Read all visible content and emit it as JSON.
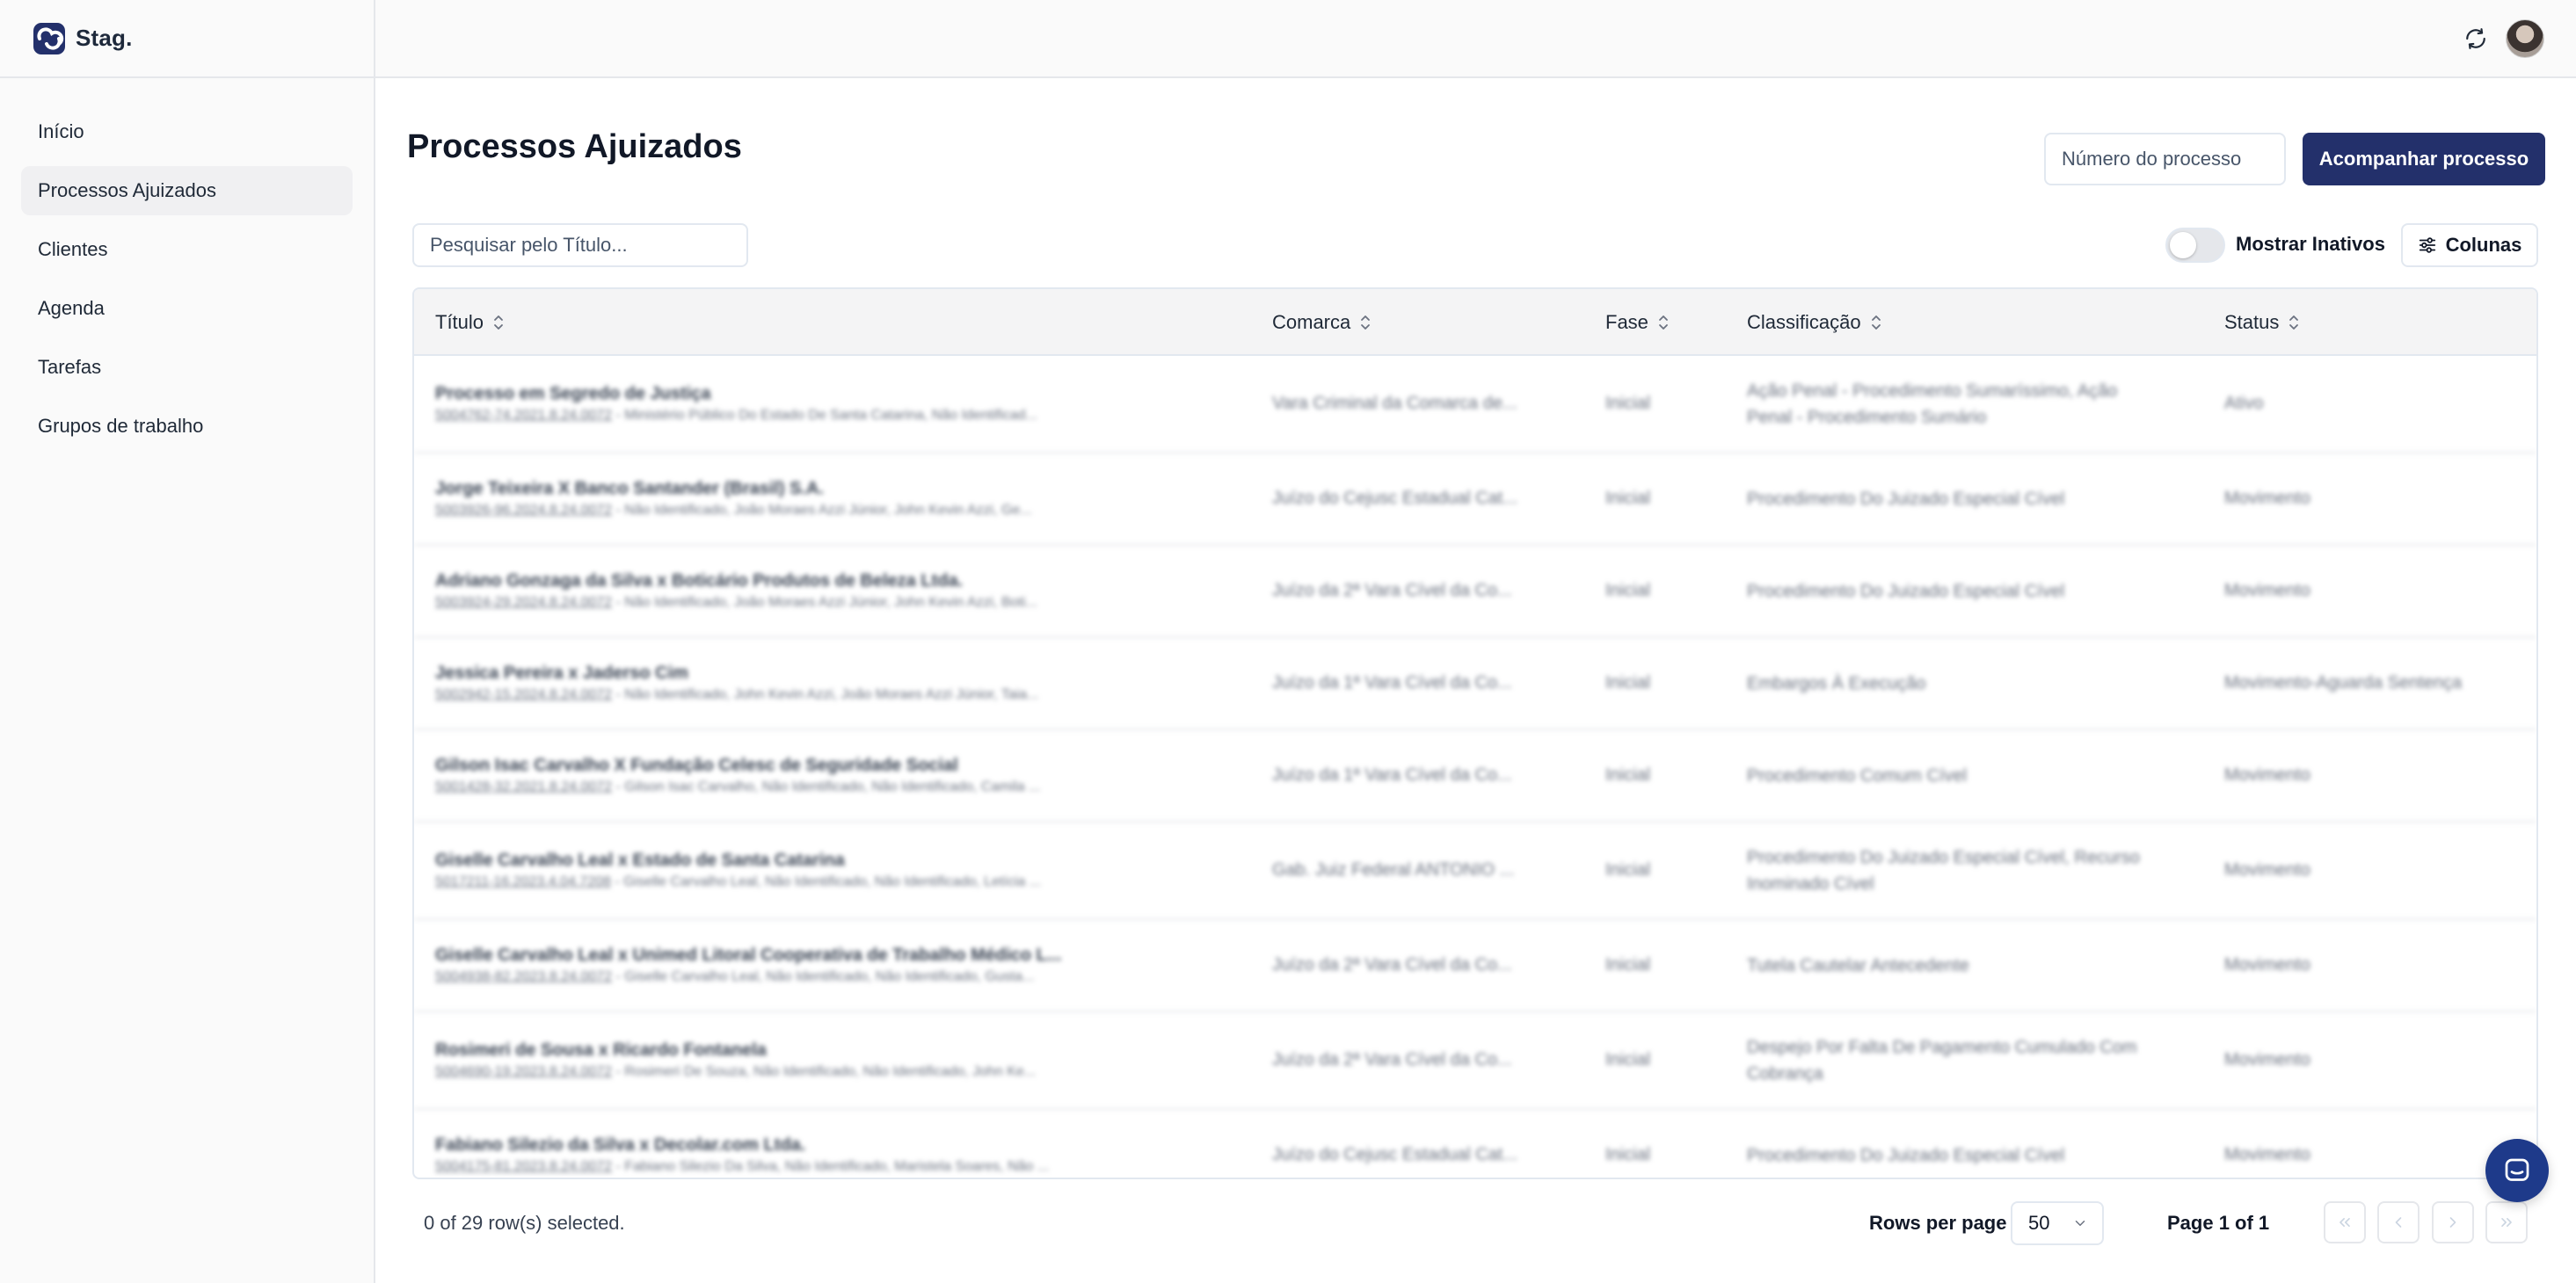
{
  "brand": {
    "name": "Stag."
  },
  "sidebar": {
    "items": [
      {
        "label": "Início",
        "active": false
      },
      {
        "label": "Processos Ajuizados",
        "active": true
      },
      {
        "label": "Clientes",
        "active": false
      },
      {
        "label": "Agenda",
        "active": false
      },
      {
        "label": "Tarefas",
        "active": false
      },
      {
        "label": "Grupos de trabalho",
        "active": false
      }
    ]
  },
  "header": {
    "refresh_icon": "refresh-icon",
    "avatar": "user-avatar"
  },
  "main": {
    "title": "Processos Ajuizados",
    "process_number_placeholder": "Número do processo",
    "follow_button": "Acompanhar processo",
    "search_placeholder": "Pesquisar pelo Título...",
    "show_inactive_label": "Mostrar Inativos",
    "show_inactive_on": false,
    "columns_button": "Colunas"
  },
  "table": {
    "columns": [
      "Título",
      "Comarca",
      "Fase",
      "Classificação",
      "Status"
    ],
    "rows": [
      {
        "title": "Processo em Segredo de Justiça",
        "number": "5004762-74.2021.8.24.0072",
        "parties": " - Ministério Público Do Estado De Santa Catarina, Não Identificad...",
        "comarca": "Vara Criminal da Comarca de...",
        "fase": "Inicial",
        "classificacao": "Ação Penal - Procedimento Sumaríssimo, Ação Penal - Procedimento Sumário",
        "status": "Ativo"
      },
      {
        "title": "Jorge Teixeira X Banco Santander (Brasil) S.A.",
        "number": "5003926-96.2024.8.24.0072",
        "parties": " - Não Identificado, João Moraes Azzi Júnior, John Kevin Azzi, Ge...",
        "comarca": "Juízo do Cejusc Estadual Cat...",
        "fase": "Inicial",
        "classificacao": "Procedimento Do Juizado Especial Cível",
        "status": "Movimento"
      },
      {
        "title": "Adriano Gonzaga da Silva x Boticário Produtos de Beleza Ltda.",
        "number": "5003924-29.2024.8.24.0072",
        "parties": " - Não Identificado, João Moraes Azzi Júnior, John Kevin Azzi, Boti...",
        "comarca": "Juízo da 2ª Vara Cível da Co...",
        "fase": "Inicial",
        "classificacao": "Procedimento Do Juizado Especial Cível",
        "status": "Movimento"
      },
      {
        "title": "Jessica Pereira x Jaderso Cim",
        "number": "5002942-15.2024.8.24.0072",
        "parties": " - Não Identificado, John Kevin Azzi, João Moraes Azzi Júnior, Taia...",
        "comarca": "Juízo da 1ª Vara Cível da Co...",
        "fase": "Inicial",
        "classificacao": "Embargos À Execução",
        "status": "Movimento-Aguarda Sentença"
      },
      {
        "title": "Gilson Isac Carvalho X Fundação Celesc de Seguridade Social",
        "number": "5001428-32.2021.8.24.0072",
        "parties": " - Gilson Isac Carvalho, Não Identificado, Não Identificado, Camila ...",
        "comarca": "Juízo da 1ª Vara Cível da Co...",
        "fase": "Inicial",
        "classificacao": "Procedimento Comum Cível",
        "status": "Movimento"
      },
      {
        "title": "Giselle Carvalho Leal x Estado de Santa Catarina",
        "number": "5017211-16.2023.4.04.7208",
        "parties": " - Giselle Carvalho Leal, Não Identificado, Não Identificado, Letícia ...",
        "comarca": "Gab. Juiz Federal ANTONIO ...",
        "fase": "Inicial",
        "classificacao": "Procedimento Do Juizado Especial Cível, Recurso Inominado Cível",
        "status": "Movimento"
      },
      {
        "title": "Giselle Carvalho Leal x Unimed Litoral Cooperativa de Trabalho Médico L...",
        "number": "5004938-82.2023.8.24.0072",
        "parties": " - Giselle Carvalho Leal, Não Identificado, Não Identificado, Gusta...",
        "comarca": "Juízo da 2ª Vara Cível da Co...",
        "fase": "Inicial",
        "classificacao": "Tutela Cautelar Antecedente",
        "status": "Movimento"
      },
      {
        "title": "Rosimeri de Sousa x Ricardo Fontanela",
        "number": "5004690-19.2023.8.24.0072",
        "parties": " - Rosimeri De Souza, Não Identificado, Não Identificado, John Ke...",
        "comarca": "Juízo da 2ª Vara Cível da Co...",
        "fase": "Inicial",
        "classificacao": "Despejo Por Falta De Pagamento Cumulado Com Cobrança",
        "status": "Movimento"
      },
      {
        "title": "Fabiano Silezio da Silva x Decolar.com Ltda.",
        "number": "5004175-81.2023.8.24.0072",
        "parties": " - Fabiano Silezio Da Silva, Não Identificado, Maristela Soares, Não ...",
        "comarca": "Juízo do Cejusc Estadual Cat...",
        "fase": "Inicial",
        "classificacao": "Procedimento Do Juizado Especial Cível",
        "status": "Movimento"
      }
    ]
  },
  "footer": {
    "selected_text": "0 of 29 row(s) selected.",
    "rows_per_page_label": "Rows per page",
    "rows_per_page_value": "50",
    "page_text": "Page 1 of 1"
  },
  "colors": {
    "primary": "#23306b",
    "sidebar_bg": "#fafafa",
    "header_bg": "#f4f4f5",
    "fab": "#1e3a8a"
  }
}
